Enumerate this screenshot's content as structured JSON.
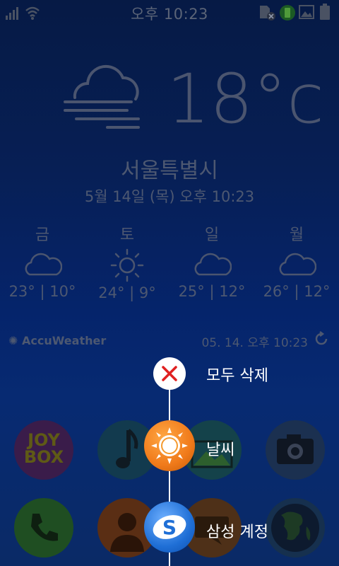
{
  "status_bar": {
    "time": "오후 10:23",
    "icons": [
      "signal-icon",
      "wifi-icon",
      "sd-card-icon",
      "evernote-icon",
      "image-icon",
      "battery-icon"
    ]
  },
  "weather": {
    "current_temp": "18°c",
    "condition_icon": "cloud-fog-icon",
    "city": "서울특별시",
    "datetime": "5월 14일 (목) 오후 10:23",
    "forecast": [
      {
        "day": "금",
        "icon": "cloud-icon",
        "temp": "23° | 10°"
      },
      {
        "day": "토",
        "icon": "sun-icon",
        "temp": "24° | 9°"
      },
      {
        "day": "일",
        "icon": "cloud-icon",
        "temp": "25° | 12°"
      },
      {
        "day": "월",
        "icon": "cloud-icon",
        "temp": "26° | 12°"
      }
    ],
    "provider": "AccuWeather",
    "updated": "05. 14. 오후 10:23"
  },
  "apps": {
    "joybox_line1": "JOY",
    "joybox_line2": "BOX"
  },
  "menu": {
    "items": [
      {
        "label": "모두 삭제",
        "icon": "close-icon"
      },
      {
        "label": "날씨",
        "icon": "weather-sun-icon"
      },
      {
        "label": "삼성 계정",
        "icon": "samsung-account-icon"
      }
    ]
  },
  "colors": {
    "background": "#061a45",
    "dim_text": "#4d5871",
    "close_red": "#e02020",
    "weather_orange": "#f07a1a",
    "samsung_blue": "#1f6fd6"
  }
}
